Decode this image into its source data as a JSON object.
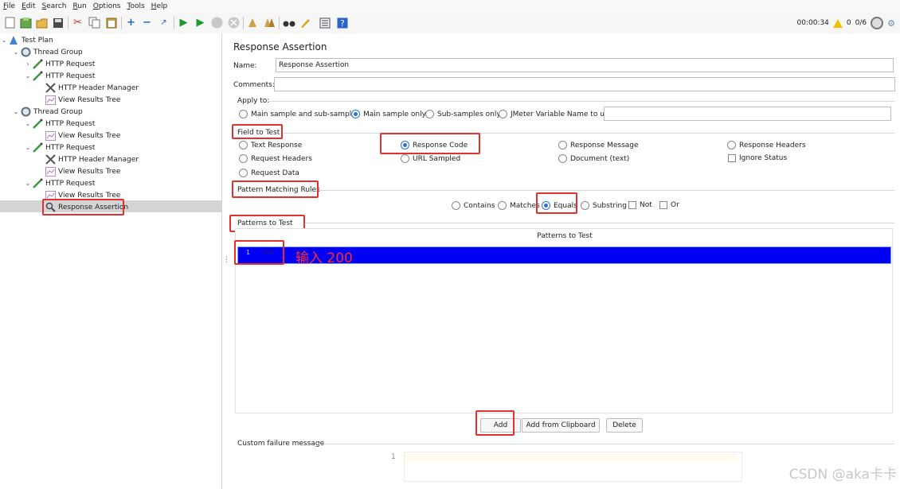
{
  "menu": [
    "File",
    "Edit",
    "Search",
    "Run",
    "Options",
    "Tools",
    "Help"
  ],
  "toolbar": {
    "icons": [
      "new-icon",
      "templates-icon",
      "open-icon",
      "save-icon",
      "cut-icon",
      "copy-icon",
      "paste-icon",
      "expand-icon",
      "collapse-icon",
      "toggle-icon",
      "start-icon",
      "start-no-pauses-icon",
      "stop-icon",
      "shutdown-icon",
      "clear-icon",
      "clear-all-icon",
      "search-icon",
      "reset-search-icon",
      "function-helper-icon",
      "help-icon"
    ],
    "timer": "00:00:34",
    "warning_count": "0",
    "threads": "0/6"
  },
  "tree": [
    {
      "label": "Test Plan",
      "icon": "test-plan-icon"
    },
    {
      "label": "Thread Group",
      "icon": "gear-icon"
    },
    {
      "label": "HTTP Request",
      "icon": "pipette-icon"
    },
    {
      "label": "HTTP Request",
      "icon": "pipette-icon"
    },
    {
      "label": "HTTP Header Manager",
      "icon": "tools-icon"
    },
    {
      "label": "View Results Tree",
      "icon": "graph-icon"
    },
    {
      "label": "Thread Group",
      "icon": "gear-icon"
    },
    {
      "label": "HTTP Request",
      "icon": "pipette-icon"
    },
    {
      "label": "View Results Tree",
      "icon": "graph-icon"
    },
    {
      "label": "HTTP Request",
      "icon": "pipette-icon"
    },
    {
      "label": "HTTP Header Manager",
      "icon": "tools-icon"
    },
    {
      "label": "View Results Tree",
      "icon": "graph-icon"
    },
    {
      "label": "HTTP Request",
      "icon": "pipette-icon"
    },
    {
      "label": "View Results Tree",
      "icon": "graph-icon"
    },
    {
      "label": "Response Assertion",
      "icon": "magnifier-icon"
    }
  ],
  "panel": {
    "title": "Response Assertion",
    "name_label": "Name:",
    "name_value": "Response Assertion",
    "comments_label": "Comments:",
    "comments_value": "",
    "apply_to": {
      "label": "Apply to:",
      "options": [
        "Main sample and sub-samples",
        "Main sample only",
        "Sub-samples only",
        "JMeter Variable Name to use"
      ],
      "selected": "Main sample only",
      "variable_value": ""
    },
    "field_to_test": {
      "label": "Field to Test",
      "options": [
        "Text Response",
        "Response Code",
        "Response Message",
        "Response Headers",
        "Request Headers",
        "URL Sampled",
        "Document (text)",
        "Request Data"
      ],
      "selected": "Response Code",
      "ignore_status_label": "Ignore Status"
    },
    "pattern_matching": {
      "label": "Pattern Matching Rules",
      "options": [
        "Contains",
        "Matches",
        "Equals",
        "Substring"
      ],
      "selected": "Equals",
      "not_label": "Not",
      "or_label": "Or"
    },
    "patterns": {
      "label": "Patterns to Test",
      "column_header": "Patterns to Test",
      "rows": [
        {
          "num": "1",
          "value": "200"
        }
      ],
      "annotation": "输入 200"
    },
    "buttons": {
      "add": "Add",
      "add_clipboard": "Add from Clipboard",
      "delete": "Delete"
    },
    "failure": {
      "label": "Custom failure message",
      "line_num": "1",
      "value": ""
    }
  },
  "watermark": "CSDN @aka卡卡",
  "colors": {
    "highlight_row": "#0000f5",
    "annotation": "#ff2a2a",
    "radio_on": "#2f6fd6",
    "selected_tree_row": "#d4d4d4"
  }
}
